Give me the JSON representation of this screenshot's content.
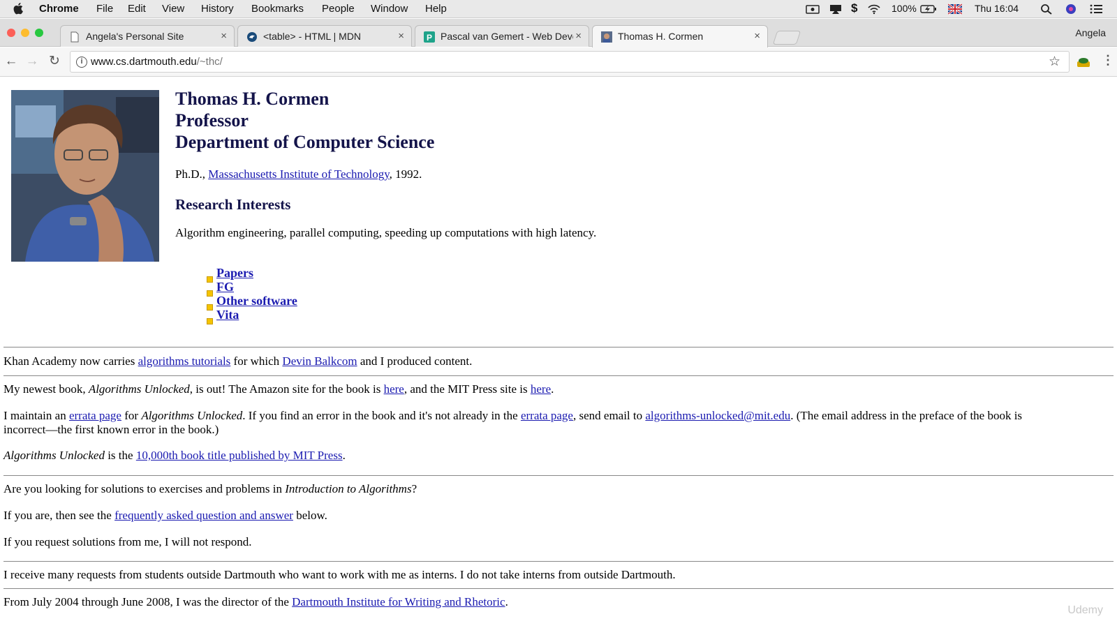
{
  "menubar": {
    "app": "Chrome",
    "items": [
      "File",
      "Edit",
      "View",
      "History",
      "Bookmarks",
      "People",
      "Window",
      "Help"
    ],
    "battery": "100%",
    "clock": "Thu 16:04"
  },
  "tabs": [
    {
      "title": "Angela's Personal Site",
      "icon": "document-icon"
    },
    {
      "title": "<table> - HTML | MDN",
      "icon": "mdn-icon"
    },
    {
      "title": "Pascal van Gemert - Web Deve",
      "icon": "p-icon"
    },
    {
      "title": "Thomas H. Cormen",
      "icon": "portrait-icon",
      "active": true
    }
  ],
  "profile": "Angela",
  "omnibox": {
    "host": "www.cs.dartmouth.edu",
    "path": "/~thc/"
  },
  "content": {
    "name": "Thomas H. Cormen",
    "role": "Professor",
    "dept": "Department of Computer Science",
    "phd_prefix": "Ph.D., ",
    "phd_link": "Massachusetts Institute of Technology",
    "phd_suffix": ", 1992.",
    "research_heading": "Research Interests",
    "research_text": "Algorithm engineering, parallel computing, speeding up computations with high latency.",
    "links": [
      "Papers",
      "FG",
      "Other software",
      "Vita"
    ],
    "khan": {
      "a": "Khan Academy now carries ",
      "l1": "algorithms tutorials",
      "b": " for which ",
      "l2": "Devin Balkcom",
      "c": " and I produced content."
    },
    "book": {
      "a": "My newest book, ",
      "i": "Algorithms Unlocked",
      "b": ", is out! The Amazon site for the book is ",
      "l1": "here",
      "c": ", and the MIT Press site is ",
      "l2": "here",
      "d": "."
    },
    "errata": {
      "a": "I maintain an ",
      "l1": "errata page",
      "b": " for ",
      "i": "Algorithms Unlocked",
      "c": ". If you find an error in the book and it's not already in the ",
      "l2": "errata page",
      "d": ", send email to ",
      "l3": "algorithms-unlocked@mit.edu",
      "e": ". (The email address in the preface of the book is",
      "f": "incorrect—the first known error in the book.)"
    },
    "mitpress": {
      "i": "Algorithms Unlocked",
      "a": " is the ",
      "l": "10,000th book title published by MIT Press",
      "b": "."
    },
    "solutions": {
      "a": "Are you looking for solutions to exercises and problems in ",
      "i": "Introduction to Algorithms",
      "b": "?"
    },
    "faq": {
      "a": "If you are, then see the ",
      "l": "frequently asked question and answer",
      "b": " below."
    },
    "norespond": "If you request solutions from me, I will not respond.",
    "interns": "I receive many requests from students outside Dartmouth who want to work with me as interns. I do not take interns from outside Dartmouth.",
    "writing": {
      "a": "From July 2004 through June 2008, I was the director of the ",
      "l": "Dartmouth Institute for Writing and Rhetoric",
      "b": "."
    }
  },
  "watermark": "Udemy",
  "colors": {
    "link": "#1a1ab0",
    "heading": "#14144a",
    "bullet": "#f5c400"
  }
}
